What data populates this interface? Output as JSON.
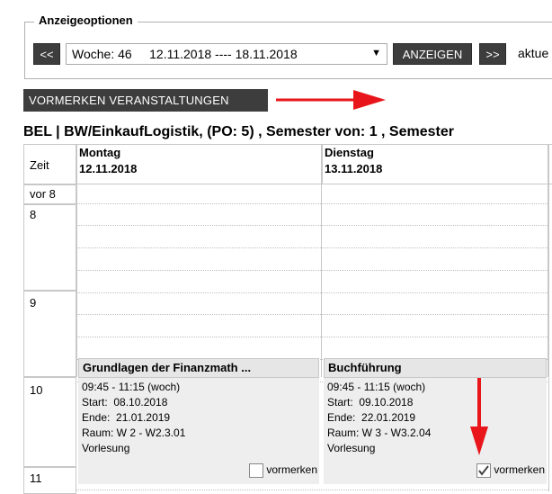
{
  "anzeigeoptionen": {
    "legend": "Anzeigeoptionen",
    "prev_label": "<<",
    "week_select_value": "Woche: 46     12.11.2018 ---- 18.11.2018",
    "anzeigen_label": "ANZEIGEN",
    "next_label": ">>",
    "aktuell_label": "aktue"
  },
  "vormerken_button_label": "VORMERKEN VERANSTALTUNGEN",
  "heading": "BEL | BW/EinkaufLogistik, (PO: 5) ,  Semester von: 1 ,  Semester",
  "timetable": {
    "zeit_header": "Zeit",
    "days": [
      {
        "name": "Montag",
        "date": "12.11.2018"
      },
      {
        "name": "Dienstag",
        "date": "13.11.2018"
      }
    ],
    "time_labels": [
      "vor 8",
      "8",
      "9",
      "10",
      "11"
    ],
    "events": [
      {
        "title": "Grundlagen der Finanzmath ...",
        "time": "09:45 - 11:15 (woch)",
        "start": "Start:  08.10.2018",
        "ende": "Ende:  21.01.2019",
        "raum": "Raum: W 2 - W2.3.01",
        "type": "Vorlesung",
        "vormerken_label": "vormerken",
        "checked": false
      },
      {
        "title": "Buchführung",
        "time": "09:45 - 11:15 (woch)",
        "start": "Start:  09.10.2018",
        "ende": "Ende:  22.01.2019",
        "raum": "Raum: W 3 - W3.2.04",
        "type": "Vorlesung",
        "vormerken_label": "vormerken",
        "checked": true
      }
    ]
  },
  "colors": {
    "button_bg": "#3d3d3d",
    "annotation_arrow": "#e8161b",
    "event_bg": "#eeeeee"
  }
}
